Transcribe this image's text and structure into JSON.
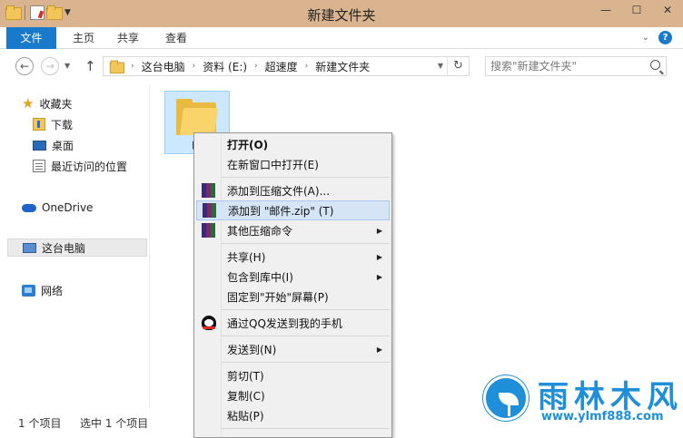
{
  "window": {
    "title": "新建文件夹"
  },
  "ribbon": {
    "tabs": [
      "文件",
      "主页",
      "共享",
      "查看"
    ]
  },
  "address": {
    "crumbs": [
      "这台电脑",
      "资料 (E:)",
      "超速度",
      "新建文件夹"
    ]
  },
  "search": {
    "placeholder": "搜索\"新建文件夹\""
  },
  "nav": {
    "favorites": "收藏夹",
    "downloads": "下载",
    "desktop": "桌面",
    "recent": "最近访问的位置",
    "onedrive": "OneDrive",
    "thispc": "这台电脑",
    "network": "网络"
  },
  "file": {
    "name": "邮"
  },
  "status": {
    "count": "1 个项目",
    "selected": "选中 1 个项目"
  },
  "context_menu": {
    "items": [
      {
        "label": "打开(O)"
      },
      {
        "label": "在新窗口中打开(E)"
      },
      {
        "label": "添加到压缩文件(A)..."
      },
      {
        "label": "添加到 \"邮件.zip\" (T)"
      },
      {
        "label": "其他压缩命令"
      },
      {
        "label": "共享(H)"
      },
      {
        "label": "包含到库中(I)"
      },
      {
        "label": "固定到\"开始\"屏幕(P)"
      },
      {
        "label": "通过QQ发送到我的手机"
      },
      {
        "label": "发送到(N)"
      },
      {
        "label": "剪切(T)"
      },
      {
        "label": "复制(C)"
      },
      {
        "label": "粘贴(P)"
      }
    ]
  },
  "watermark": {
    "title": "雨林木风",
    "url": "www.ylmf888.com"
  },
  "colors": {
    "titlebar": "#d9b48f",
    "accent": "#1979ca",
    "selection": "#cce8ff",
    "menu_hover": "#d5e5f6"
  }
}
